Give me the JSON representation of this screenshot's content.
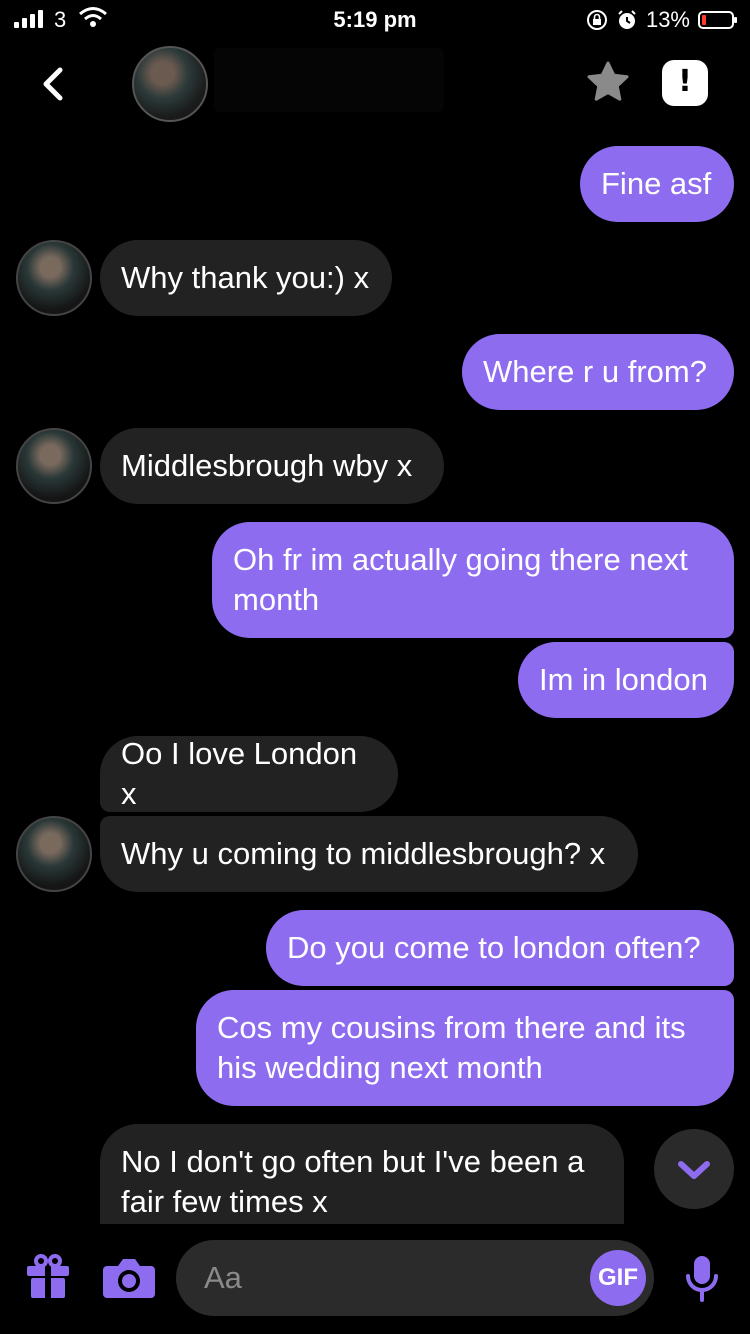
{
  "status_bar": {
    "carrier": "3",
    "time": "5:19 pm",
    "battery_text": "13%",
    "battery_level": 0.13,
    "icons": [
      "signal-icon",
      "wifi-icon",
      "orientation-lock-icon",
      "alarm-icon",
      "battery-icon"
    ]
  },
  "header": {
    "icons": [
      "back-icon",
      "star-icon",
      "report-icon"
    ],
    "report_glyph": "!"
  },
  "messages": [
    {
      "side": "out",
      "text": "Fine asf"
    },
    {
      "side": "in",
      "text": "Why thank you:) x"
    },
    {
      "side": "out",
      "text": "Where r u from?"
    },
    {
      "side": "in",
      "text": "Middlesbrough wby x"
    },
    {
      "side": "out",
      "text": "Oh fr im actually going there next month"
    },
    {
      "side": "out",
      "text": "Im in london"
    },
    {
      "side": "in",
      "text": "Oo I love London x"
    },
    {
      "side": "in",
      "text": "Why u coming to middlesbrough? x"
    },
    {
      "side": "out",
      "text": "Do you come to london often?"
    },
    {
      "side": "out",
      "text": "Cos my cousins from there and its his wedding next month"
    },
    {
      "side": "in",
      "text": "No I don't go often but I've been a fair few times x"
    }
  ],
  "composer": {
    "placeholder": "Aa",
    "gif_label": "GIF",
    "icons": [
      "gift-icon",
      "camera-icon",
      "microphone-icon",
      "chevron-down-icon"
    ]
  },
  "colors": {
    "accent": "#8e6cf0",
    "incoming_bubble": "#222222",
    "background": "#000000"
  }
}
